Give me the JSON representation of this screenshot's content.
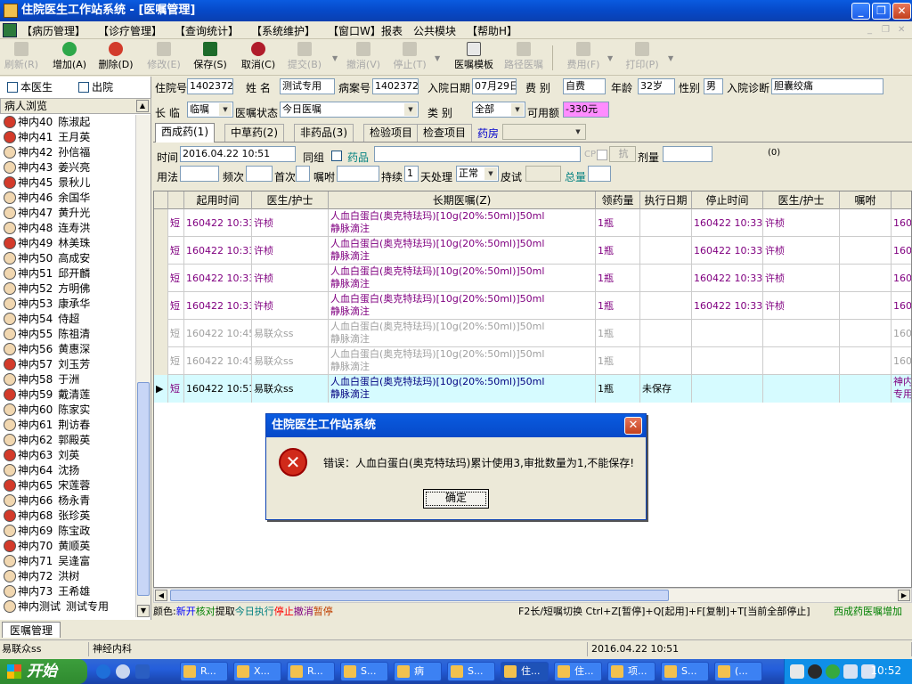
{
  "window": {
    "title": "住院医生工作站系统 - [医嘱管理]"
  },
  "menu": [
    "【病历管理】",
    "【诊疗管理】",
    "【查询统计】",
    "【系统维护】",
    "【窗口W】",
    "报表",
    "公共模块",
    "【帮助H】"
  ],
  "toolbar": [
    {
      "label": "刷新(R)",
      "enabled": false
    },
    {
      "label": "增加(A)",
      "enabled": true,
      "icon": "add-icon"
    },
    {
      "label": "删除(D)",
      "enabled": true,
      "icon": "delete-icon"
    },
    {
      "label": "修改(E)",
      "enabled": false
    },
    {
      "label": "保存(S)",
      "enabled": true,
      "icon": "save-icon"
    },
    {
      "label": "取消(C)",
      "enabled": true,
      "icon": "undo-icon"
    },
    {
      "label": "提交(B)",
      "enabled": false
    },
    {
      "label": "撤消(V)",
      "enabled": false
    },
    {
      "label": "停止(T)",
      "enabled": false
    },
    {
      "label": "医嘱模板",
      "enabled": true,
      "icon": "template-icon"
    },
    {
      "label": "路径医嘱",
      "enabled": false
    },
    {
      "label": "费用(F)",
      "enabled": false
    },
    {
      "label": "打印(P)",
      "enabled": false
    }
  ],
  "left": {
    "filter_doctor": "本医生",
    "filter_discharge": "出院",
    "header": "病人浏览",
    "patients": [
      {
        "bed": "神内40",
        "name": "陈淑起",
        "sex": "f"
      },
      {
        "bed": "神内41",
        "name": "王月英",
        "sex": "f"
      },
      {
        "bed": "神内42",
        "name": "孙信福",
        "sex": "m"
      },
      {
        "bed": "神内43",
        "name": "姜兴亮",
        "sex": "m"
      },
      {
        "bed": "神内45",
        "name": "景秋儿",
        "sex": "f"
      },
      {
        "bed": "神内46",
        "name": "余国华",
        "sex": "m"
      },
      {
        "bed": "神内47",
        "name": "黄升光",
        "sex": "m"
      },
      {
        "bed": "神内48",
        "name": "连寿洪",
        "sex": "m"
      },
      {
        "bed": "神内49",
        "name": "林美珠",
        "sex": "f"
      },
      {
        "bed": "神内50",
        "name": "高成安",
        "sex": "m"
      },
      {
        "bed": "神内51",
        "name": "邱开麟",
        "sex": "m"
      },
      {
        "bed": "神内52",
        "name": "方明佛",
        "sex": "m"
      },
      {
        "bed": "神内53",
        "name": "康承华",
        "sex": "m"
      },
      {
        "bed": "神内54",
        "name": "侍超",
        "sex": "m"
      },
      {
        "bed": "神内55",
        "name": "陈祖清",
        "sex": "m"
      },
      {
        "bed": "神内56",
        "name": "黄惠深",
        "sex": "m"
      },
      {
        "bed": "神内57",
        "name": "刘玉芳",
        "sex": "f"
      },
      {
        "bed": "神内58",
        "name": "于洲",
        "sex": "m"
      },
      {
        "bed": "神内59",
        "name": "戴清莲",
        "sex": "f"
      },
      {
        "bed": "神内60",
        "name": "陈家实",
        "sex": "m"
      },
      {
        "bed": "神内61",
        "name": "荆访春",
        "sex": "m"
      },
      {
        "bed": "神内62",
        "name": "郭殿英",
        "sex": "m"
      },
      {
        "bed": "神内63",
        "name": "刘英",
        "sex": "f"
      },
      {
        "bed": "神内64",
        "name": "沈扬",
        "sex": "m"
      },
      {
        "bed": "神内65",
        "name": "宋莲蓉",
        "sex": "f"
      },
      {
        "bed": "神内66",
        "name": "杨永青",
        "sex": "m"
      },
      {
        "bed": "神内68",
        "name": "张珍英",
        "sex": "f"
      },
      {
        "bed": "神内69",
        "name": "陈宝政",
        "sex": "m"
      },
      {
        "bed": "神内70",
        "name": "黄顺英",
        "sex": "f"
      },
      {
        "bed": "神内71",
        "name": "吴逢富",
        "sex": "m"
      },
      {
        "bed": "神内72",
        "name": "洪树",
        "sex": "m"
      },
      {
        "bed": "神内73",
        "name": "王希雄",
        "sex": "m"
      },
      {
        "bed": "神内测试",
        "name": "测试专用",
        "sex": "m"
      }
    ]
  },
  "patient": {
    "inpatient_no_label": "住院号",
    "inpatient_no": "1402372",
    "name_label": "姓 名",
    "name": "测试专用",
    "record_no_label": "病案号",
    "record_no": "1402372",
    "admit_date_label": "入院日期",
    "admit_date": "07月29日",
    "fee_type_label": "费 别",
    "fee_type": "自费",
    "age_label": "年龄",
    "age": "32岁",
    "sex_label": "性别",
    "sex": "男",
    "diagnosis_label": "入院诊断",
    "diagnosis": "胆囊绞痛",
    "long_short_label": "长 临",
    "long_short": "临嘱",
    "order_status_label": "医嘱状态",
    "order_status": "今日医嘱",
    "category_label": "类 别",
    "category": "全部",
    "balance_label": "可用额",
    "balance": "-330元"
  },
  "tabs": [
    "西成药(1)",
    "中草药(2)",
    "非药品(3)",
    "检验项目",
    "检查项目"
  ],
  "pharmacy_label": "药房",
  "entry": {
    "time_label": "时间",
    "time": "2016.04.22 10:51",
    "group_label": "同组",
    "drug_label": "药品",
    "cp_label": "CP",
    "anti_label": "抗",
    "dose_label": "剂量",
    "counter": "(0)",
    "usage_label": "用法",
    "freq_label": "频次",
    "first_label": "首次",
    "note_label": "嘱咐",
    "duration_label": "持续",
    "duration": "1",
    "day_label": "天处理",
    "process": "正常",
    "skin_test_label": "皮试",
    "total_label": "总量"
  },
  "grid": {
    "headers": [
      "起用时间",
      "医生/护士",
      "长期医嘱(Z)",
      "领药量",
      "执行日期",
      "停止时间",
      "医生/护士",
      "嘱咐"
    ],
    "rows": [
      {
        "type": "短",
        "start": "160422 10:33",
        "doctor": "许桢",
        "order": "人血白蛋白(奥克特珐玛)[10g(20%:50ml)]50ml",
        "route": "静脉滴注",
        "qty": "1瓶",
        "exec": "",
        "stop": "160422 10:33",
        "stop_doctor": "许桢",
        "note": "",
        "extra": "160",
        "style": "purple"
      },
      {
        "type": "短",
        "start": "160422 10:33",
        "doctor": "许桢",
        "order": "人血白蛋白(奥克特珐玛)[10g(20%:50ml)]50ml",
        "route": "静脉滴注",
        "qty": "1瓶",
        "exec": "",
        "stop": "160422 10:33",
        "stop_doctor": "许桢",
        "note": "",
        "extra": "160",
        "style": "purple"
      },
      {
        "type": "短",
        "start": "160422 10:33",
        "doctor": "许桢",
        "order": "人血白蛋白(奥克特珐玛)[10g(20%:50ml)]50ml",
        "route": "静脉滴注",
        "qty": "1瓶",
        "exec": "",
        "stop": "160422 10:33",
        "stop_doctor": "许桢",
        "note": "",
        "extra": "160",
        "style": "purple"
      },
      {
        "type": "短",
        "start": "160422 10:33",
        "doctor": "许桢",
        "order": "人血白蛋白(奥克特珐玛)[10g(20%:50ml)]50ml",
        "route": "静脉滴注",
        "qty": "1瓶",
        "exec": "",
        "stop": "160422 10:33",
        "stop_doctor": "许桢",
        "note": "",
        "extra": "160",
        "style": "purple"
      },
      {
        "type": "短",
        "start": "160422 10:45",
        "doctor": "易联众ss",
        "order": "人血白蛋白(奥克特珐玛)[10g(20%:50ml)]50ml",
        "route": "静脉滴注",
        "qty": "1瓶",
        "exec": "",
        "stop": "",
        "stop_doctor": "",
        "note": "",
        "extra": "160",
        "style": "grey"
      },
      {
        "type": "短",
        "start": "160422 10:45",
        "doctor": "易联众ss",
        "order": "人血白蛋白(奥克特珐玛)[10g(20%:50ml)]50ml",
        "route": "静脉滴注",
        "qty": "1瓶",
        "exec": "",
        "stop": "",
        "stop_doctor": "",
        "note": "",
        "extra": "160",
        "style": "grey"
      },
      {
        "type": "短",
        "start": "160422 10:51",
        "doctor": "易联众ss",
        "order": "人血白蛋白(奥克特珐玛)[10g(20%:50ml)]50ml",
        "route": "静脉滴注",
        "qty": "1瓶",
        "exec": "未保存",
        "stop": "",
        "stop_doctor": "",
        "note": "",
        "extra": "神内",
        "extra2": "专用",
        "style": "current"
      }
    ]
  },
  "legend": {
    "prefix": "颜色:",
    "items": [
      {
        "text": "新开",
        "color": "#0000ff"
      },
      {
        "text": "核对",
        "color": "#008000"
      },
      {
        "text": "提取",
        "color": "#000000"
      },
      {
        "text": "今日执行",
        "color": "#008080"
      },
      {
        "text": "停止",
        "color": "#ff0000"
      },
      {
        "text": "撤消",
        "color": "#800080"
      },
      {
        "text": "暂停",
        "color": "#c04000"
      }
    ],
    "hint": "F2长/短嘱切换 Ctrl+Z[暂停]+Q[起用]+F[复制]+T[当前全部停止]",
    "hint_tail": "西成药医嘱增加"
  },
  "status": {
    "tab": "医嘱管理",
    "user": "易联众ss",
    "dept": "神经内科",
    "datetime": "2016.04.22 10:51"
  },
  "dialog": {
    "title": "住院医生工作站系统",
    "message": "错误：人血白蛋白(奥克特珐玛)累计使用3,审批数量为1,不能保存!",
    "ok": "确定"
  },
  "taskbar": {
    "start": "开始",
    "tasks": [
      "R...",
      "X...",
      "R...",
      "S...",
      "病",
      "S...",
      "住...",
      "住...",
      "项...",
      "S...",
      "(..."
    ],
    "clock": "10:52"
  }
}
